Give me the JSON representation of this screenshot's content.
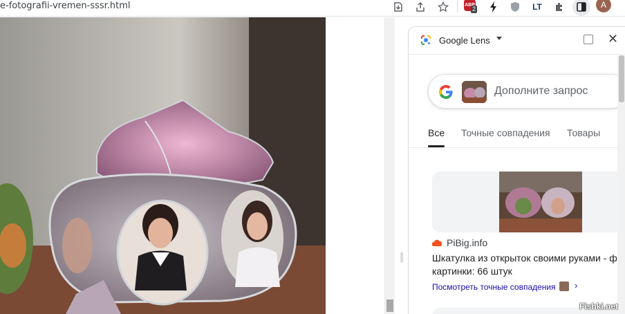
{
  "browser": {
    "url_fragment": "e-fotografii-vremen-sssr.html",
    "abp_badge": "2",
    "abp_label": "ABP",
    "avatar_letter": "A",
    "extension_lt_label": "LT"
  },
  "lens_panel": {
    "title": "Google Lens",
    "search_placeholder": "Дополните запрос",
    "tabs": [
      {
        "label": "Все",
        "active": true
      },
      {
        "label": "Точные совпадения",
        "active": false
      },
      {
        "label": "Товары",
        "active": false
      }
    ],
    "result": {
      "source": "PiBig.info",
      "title_line1": "Шкатулка из открыток своими руками - ф",
      "title_line2": "картинки: 66 штук",
      "link": "Посмотреть точные совпадения",
      "link_chevron": "›"
    }
  },
  "watermark": "Fishki.net",
  "colors": {
    "accent_link": "#1a0dab",
    "abp_red": "#c6202b",
    "source_orange": "#f4511e"
  }
}
